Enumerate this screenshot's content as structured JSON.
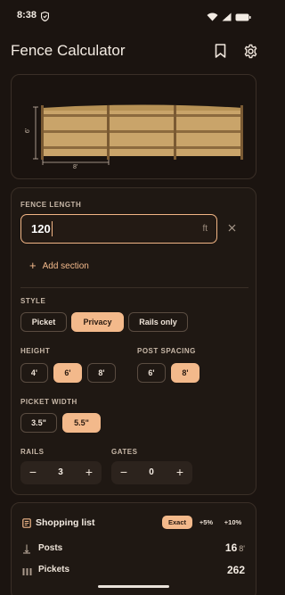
{
  "status": {
    "time": "8:38"
  },
  "app": {
    "title": "Fence Calculator"
  },
  "preview": {
    "height_label": "6'",
    "width_label": "8'"
  },
  "fence_length": {
    "label": "FENCE LENGTH",
    "value": "120",
    "unit": "ft",
    "add_section": "Add section"
  },
  "style": {
    "label": "STYLE",
    "options": [
      "Picket",
      "Privacy",
      "Rails only"
    ],
    "selected": "Privacy"
  },
  "height": {
    "label": "HEIGHT",
    "options": [
      "4'",
      "6'",
      "8'"
    ],
    "selected": "6'"
  },
  "post_spacing": {
    "label": "POST SPACING",
    "options": [
      "6'",
      "8'"
    ],
    "selected": "8'"
  },
  "picket_width": {
    "label": "PICKET WIDTH",
    "options": [
      "3.5\"",
      "5.5\""
    ],
    "selected": "5.5\""
  },
  "rails": {
    "label": "RAILS",
    "value": "3",
    "minus": "−",
    "plus": "+"
  },
  "gates": {
    "label": "GATES",
    "value": "0",
    "minus": "−",
    "plus": "+"
  },
  "shopping": {
    "title": "Shopping list",
    "modes": [
      "Exact",
      "+5%",
      "+10%"
    ],
    "selected_mode": "Exact",
    "rows": [
      {
        "label": "Posts",
        "value": "16",
        "sub": "8'"
      },
      {
        "label": "Pickets",
        "value": "262",
        "sub": ""
      }
    ]
  },
  "colors": {
    "background": "#1b1410",
    "accent": "#f3b98b",
    "wood": "#c9a46a",
    "post": "#8c6a3e"
  },
  "icons": [
    "shield-icon",
    "wifi-icon",
    "signal-icon",
    "battery-icon",
    "bookmark-icon",
    "settings-icon",
    "close-icon",
    "plus-icon",
    "list-icon",
    "post-icon",
    "picket-icon"
  ]
}
